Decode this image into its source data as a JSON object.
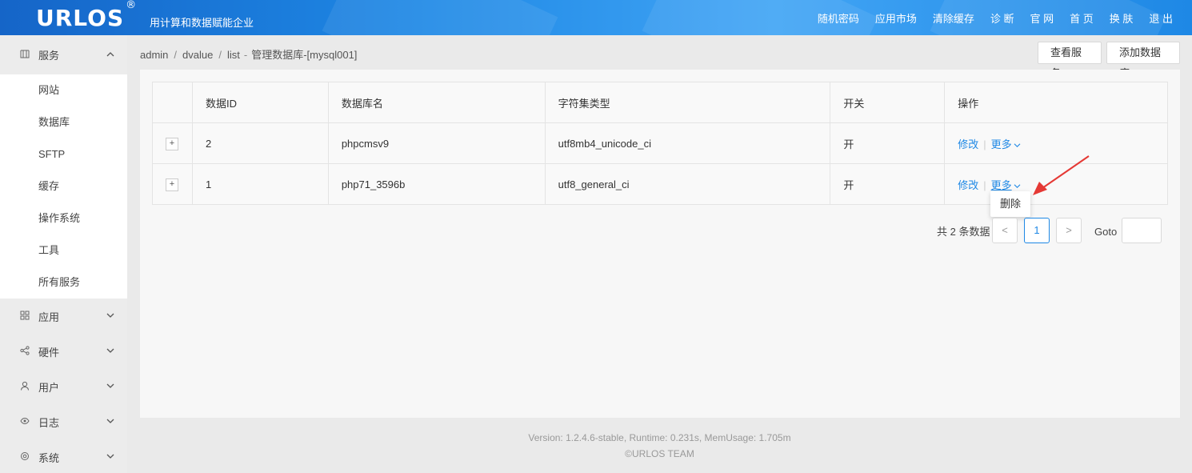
{
  "header": {
    "logo": "URLOS",
    "logo_mark": "®",
    "slogan": "用计算和数据赋能企业",
    "nav": [
      "随机密码",
      "应用市场",
      "清除缓存",
      "诊 断",
      "官 网",
      "首 页",
      "换 肤",
      "退 出"
    ]
  },
  "sidebar": {
    "services": {
      "label": "服务",
      "icon": "grid-icon",
      "items": [
        "网站",
        "数据库",
        "SFTP",
        "缓存",
        "操作系统",
        "工具",
        "所有服务"
      ]
    },
    "groups": [
      {
        "label": "应用",
        "icon": "apps-icon"
      },
      {
        "label": "硬件",
        "icon": "share-icon"
      },
      {
        "label": "用户",
        "icon": "user-icon"
      },
      {
        "label": "日志",
        "icon": "eye-icon"
      },
      {
        "label": "系统",
        "icon": "gear-icon"
      }
    ]
  },
  "breadcrumb": {
    "parts": [
      "admin",
      "dvalue",
      "list"
    ],
    "title": "管理数据库-[mysql001]"
  },
  "actions": {
    "view_service": "查看服务",
    "add_database": "添加数据库"
  },
  "table": {
    "headers": [
      "数据ID",
      "数据库名",
      "字符集类型",
      "开关",
      "操作"
    ],
    "rows": [
      {
        "id": "2",
        "name": "phpcmsv9",
        "charset": "utf8mb4_unicode_ci",
        "switch": "开",
        "edit": "修改",
        "more": "更多"
      },
      {
        "id": "1",
        "name": "php71_3596b",
        "charset": "utf8_general_ci",
        "switch": "开",
        "edit": "修改",
        "more": "更多"
      }
    ],
    "dropdown_item": "删除"
  },
  "pagination": {
    "total": "共 2 条数据",
    "prev": "<",
    "page": "1",
    "next": ">",
    "goto": "Goto"
  },
  "footer": {
    "version_line": "Version: 1.2.4.6-stable,   Runtime: 0.231s,   MemUsage: 1.705m",
    "copyright": "©URLOS TEAM"
  },
  "colors": {
    "accent": "#1e88e5",
    "arrow": "#e53935"
  }
}
